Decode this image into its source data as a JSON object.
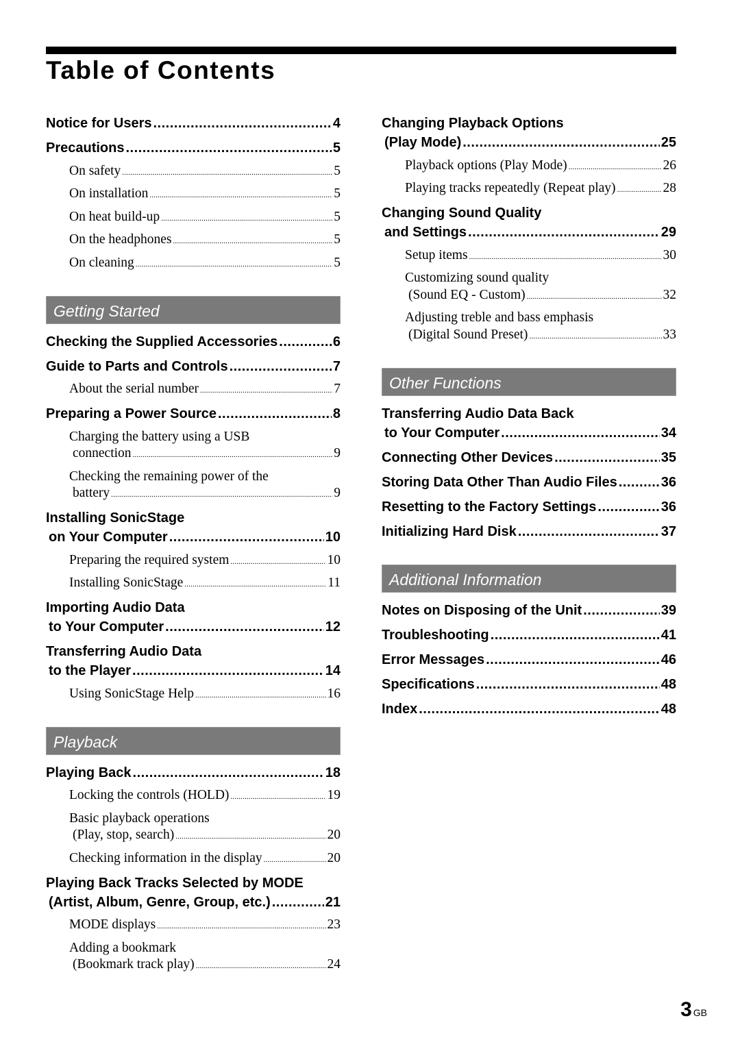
{
  "title": "Table of Contents",
  "page": {
    "number": "3",
    "suffix": "GB"
  },
  "colors": {
    "section_header_bg": "#7a7a7a",
    "rule": "#000000"
  },
  "left": {
    "intro": [
      {
        "type": "main",
        "text": "Notice for Users",
        "page": "4"
      },
      {
        "type": "main",
        "text": "Precautions",
        "page": "5"
      },
      {
        "type": "sub",
        "text": "On safety",
        "page": "5"
      },
      {
        "type": "sub",
        "text": "On installation",
        "page": "5"
      },
      {
        "type": "sub",
        "text": "On heat build-up",
        "page": "5"
      },
      {
        "type": "sub",
        "text": "On the headphones",
        "page": "5"
      },
      {
        "type": "sub",
        "text": "On cleaning",
        "page": "5"
      }
    ],
    "getting_started": {
      "heading": "Getting Started",
      "entries": [
        {
          "type": "main",
          "text": "Checking the Supplied Accessories",
          "page": "6"
        },
        {
          "type": "main",
          "text": "Guide to Parts and Controls",
          "page": "7"
        },
        {
          "type": "sub",
          "text": "About the serial number",
          "page": "7"
        },
        {
          "type": "main",
          "text": "Preparing a Power Source",
          "page": "8"
        },
        {
          "type": "sub",
          "line1": "Charging the battery using a USB",
          "text": "connection",
          "page": "9"
        },
        {
          "type": "sub",
          "line1": "Checking the remaining power of the",
          "text": "battery",
          "page": "9"
        },
        {
          "type": "main",
          "line1": "Installing SonicStage",
          "text": "on Your Computer",
          "page": "10"
        },
        {
          "type": "sub",
          "text": "Preparing the required system",
          "page": "10"
        },
        {
          "type": "sub",
          "text": "Installing SonicStage",
          "page": "11"
        },
        {
          "type": "main",
          "line1": "Importing Audio Data",
          "text": "to Your Computer",
          "page": "12"
        },
        {
          "type": "main",
          "line1": "Transferring Audio Data",
          "text": "to the Player",
          "page": "14"
        },
        {
          "type": "sub",
          "text": "Using SonicStage Help",
          "page": "16"
        }
      ]
    },
    "playback": {
      "heading": "Playback",
      "entries": [
        {
          "type": "main",
          "text": "Playing Back",
          "page": "18"
        },
        {
          "type": "sub",
          "text": "Locking the controls (HOLD)",
          "page": "19"
        },
        {
          "type": "sub",
          "line1": "Basic playback operations",
          "text": "(Play, stop, search)",
          "page": "20"
        },
        {
          "type": "sub",
          "text": "Checking information in the display",
          "page": "20"
        },
        {
          "type": "main",
          "line1": "Playing Back Tracks Selected by MODE",
          "text": "(Artist, Album, Genre, Group, etc.)",
          "page": "21"
        },
        {
          "type": "sub",
          "text": "MODE displays",
          "page": "23"
        },
        {
          "type": "sub",
          "line1": "Adding a bookmark",
          "text": "(Bookmark track play)",
          "page": "24"
        }
      ]
    }
  },
  "right": {
    "intro": [
      {
        "type": "main",
        "line1": "Changing Playback Options",
        "text": "(Play Mode)",
        "page": "25"
      },
      {
        "type": "sub",
        "text": "Playback options (Play Mode)",
        "page": "26"
      },
      {
        "type": "sub",
        "text": "Playing tracks repeatedly (Repeat play)",
        "page": "28"
      },
      {
        "type": "main",
        "line1": "Changing Sound Quality",
        "text": "and Settings",
        "page": "29"
      },
      {
        "type": "sub",
        "text": "Setup items",
        "page": "30"
      },
      {
        "type": "sub",
        "line1": "Customizing sound quality",
        "text": "(Sound EQ - Custom)",
        "page": "32"
      },
      {
        "type": "sub",
        "line1": "Adjusting treble and bass emphasis",
        "text": "(Digital Sound Preset)",
        "page": "33"
      }
    ],
    "other_functions": {
      "heading": "Other Functions",
      "entries": [
        {
          "type": "main",
          "line1": "Transferring Audio Data Back",
          "text": "to Your Computer",
          "page": "34"
        },
        {
          "type": "main",
          "text": "Connecting Other Devices",
          "page": "35"
        },
        {
          "type": "main",
          "text": "Storing Data Other Than Audio Files",
          "page": "36"
        },
        {
          "type": "main",
          "text": "Resetting to the Factory Settings",
          "page": "36"
        },
        {
          "type": "main",
          "text": "Initializing Hard Disk",
          "page": "37"
        }
      ]
    },
    "additional_information": {
      "heading": "Additional Information",
      "entries": [
        {
          "type": "main",
          "text": "Notes on Disposing of the Unit",
          "page": "39"
        },
        {
          "type": "main",
          "text": "Troubleshooting",
          "page": "41"
        },
        {
          "type": "main",
          "text": "Error Messages",
          "page": "46"
        },
        {
          "type": "main",
          "text": "Specifications",
          "page": "48"
        },
        {
          "type": "main",
          "text": "Index",
          "page": "48"
        }
      ]
    }
  }
}
